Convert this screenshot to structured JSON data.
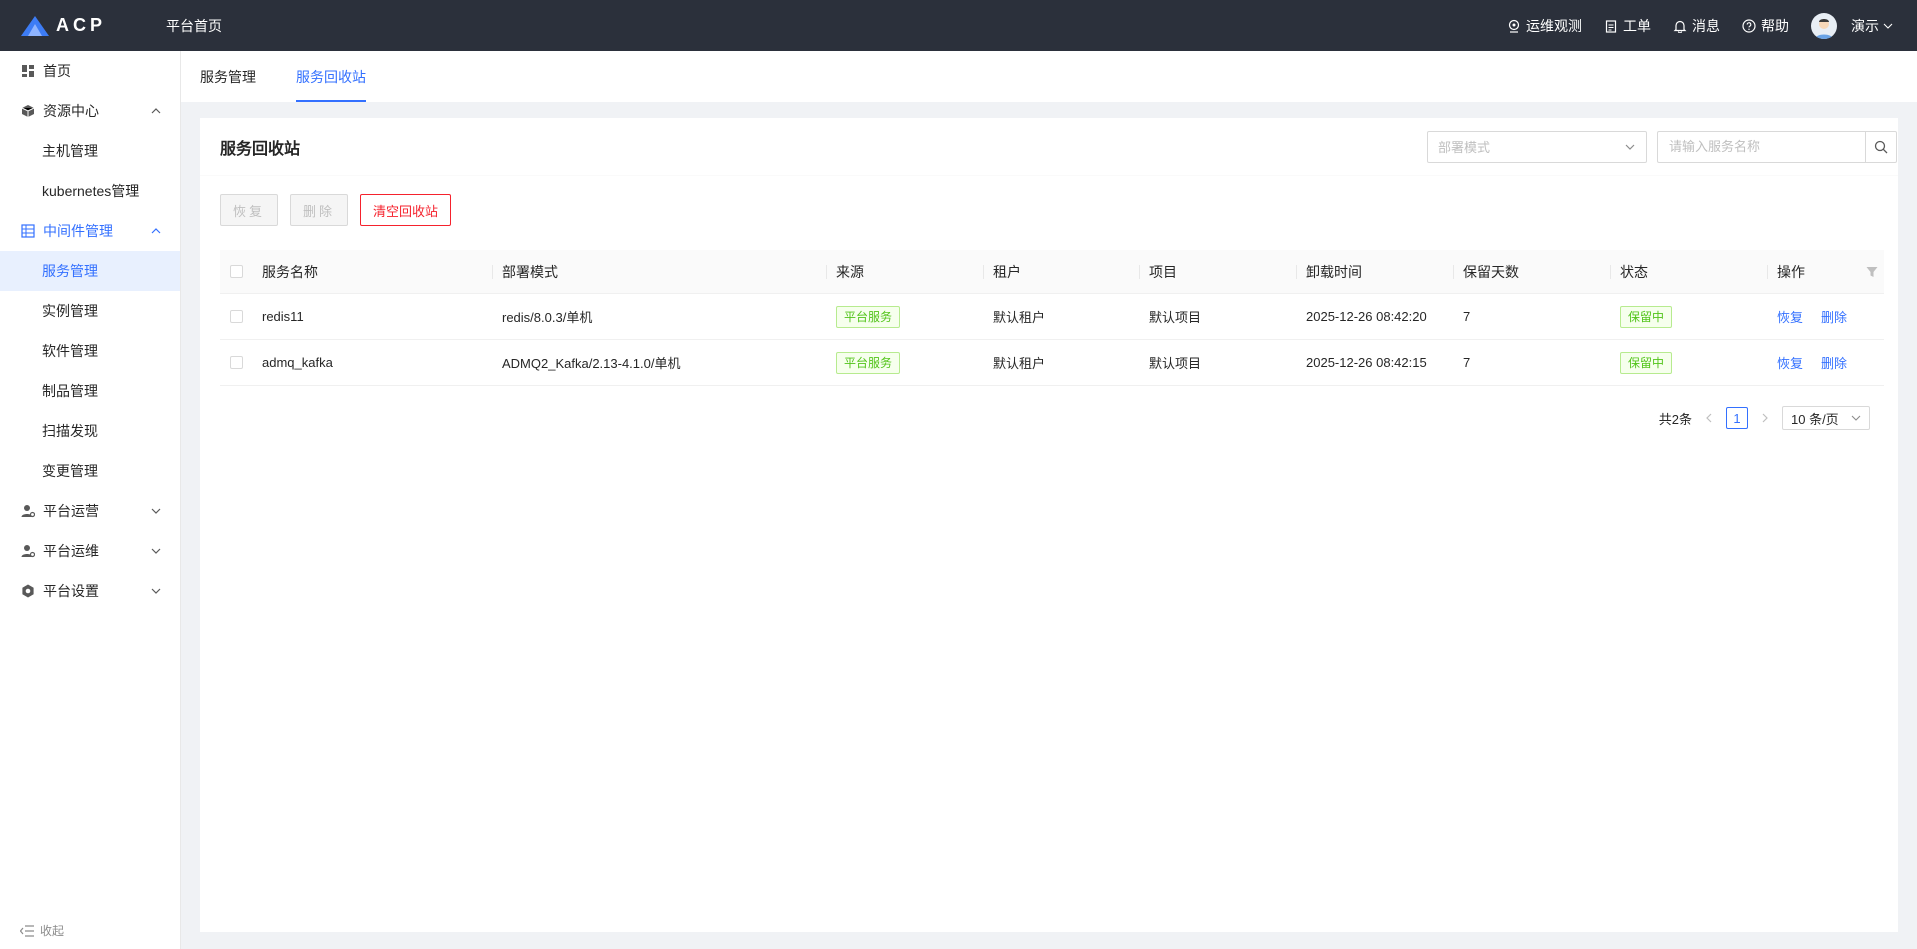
{
  "app": {
    "logo_text": "ACP",
    "home_link": "平台首页"
  },
  "topbar": {
    "items": [
      {
        "label": "运维观测",
        "icon": "monitor-icon"
      },
      {
        "label": "工单",
        "icon": "clipboard-icon"
      },
      {
        "label": "消息",
        "icon": "bell-icon"
      },
      {
        "label": "帮助",
        "icon": "help-icon"
      }
    ],
    "user_name": "演示"
  },
  "sidebar": {
    "items": [
      {
        "label": "首页",
        "icon": "dashboard-icon"
      },
      {
        "label": "资源中心",
        "icon": "cube-icon"
      },
      {
        "label": "主机管理"
      },
      {
        "label": "kubernetes管理"
      },
      {
        "label": "中间件管理",
        "icon": "middleware-icon"
      },
      {
        "label": "服务管理"
      },
      {
        "label": "实例管理"
      },
      {
        "label": "软件管理"
      },
      {
        "label": "制品管理"
      },
      {
        "label": "扫描发现"
      },
      {
        "label": "变更管理"
      },
      {
        "label": "平台运营",
        "icon": "user-gear-icon"
      },
      {
        "label": "平台运维",
        "icon": "user-gear-icon"
      },
      {
        "label": "平台设置",
        "icon": "settings-icon"
      }
    ],
    "collapse_label": "收起"
  },
  "tabs": [
    {
      "label": "服务管理"
    },
    {
      "label": "服务回收站"
    }
  ],
  "card": {
    "title": "服务回收站",
    "mode_select_placeholder": "部署模式",
    "search_placeholder": "请输入服务名称"
  },
  "toolbar": {
    "restore_label": "恢复",
    "delete_label": "删除",
    "clear_label": "清空回收站"
  },
  "table": {
    "headers": {
      "name": "服务名称",
      "mode": "部署模式",
      "source": "来源",
      "tenant": "租户",
      "project": "项目",
      "uninstall_time": "卸载时间",
      "keep_days": "保留天数",
      "state": "状态",
      "ops": "操作"
    },
    "rows": [
      {
        "name": "redis11",
        "mode": "redis/8.0.3/单机",
        "source": "平台服务",
        "tenant": "默认租户",
        "project": "默认项目",
        "uninstall_time": "2025-12-26 08:42:20",
        "keep_days": "7",
        "state": "保留中",
        "op_restore": "恢复",
        "op_delete": "删除"
      },
      {
        "name": "admq_kafka",
        "mode": "ADMQ2_Kafka/2.13-4.1.0/单机",
        "source": "平台服务",
        "tenant": "默认租户",
        "project": "默认项目",
        "uninstall_time": "2025-12-26 08:42:15",
        "keep_days": "7",
        "state": "保留中",
        "op_restore": "恢复",
        "op_delete": "删除"
      }
    ]
  },
  "pagination": {
    "total_text": "共2条",
    "current_page": "1",
    "page_size": "10 条/页"
  },
  "colors": {
    "topbar": "#2b303b",
    "accent": "#3370ff",
    "danger": "#f5222d",
    "success": "#52c41a"
  }
}
